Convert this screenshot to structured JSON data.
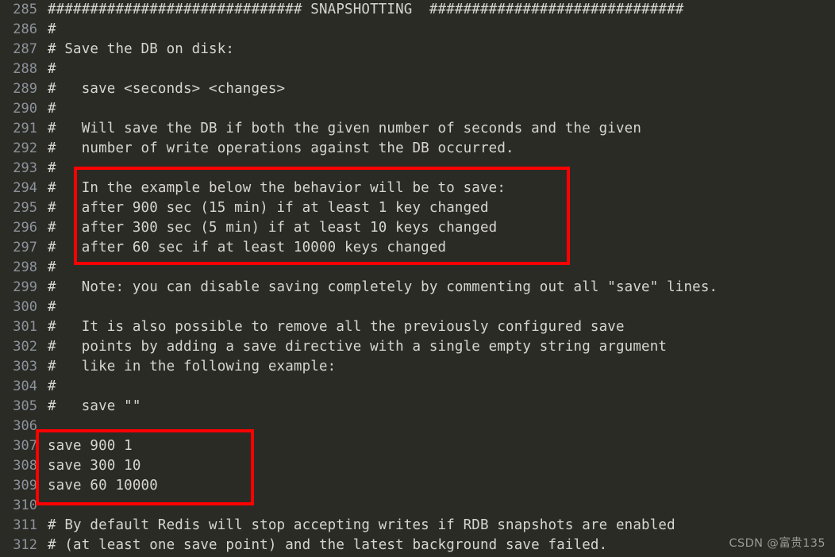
{
  "editor": {
    "background_color": "#2b2b26",
    "text_color": "#d6d6cf",
    "gutter_color": "#8d939b",
    "first_line_number": 285,
    "lines": [
      {
        "number": "285",
        "text": "############################## SNAPSHOTTING  ##############################"
      },
      {
        "number": "286",
        "text": "#"
      },
      {
        "number": "287",
        "text": "# Save the DB on disk:"
      },
      {
        "number": "288",
        "text": "#"
      },
      {
        "number": "289",
        "text": "#   save <seconds> <changes>"
      },
      {
        "number": "290",
        "text": "#"
      },
      {
        "number": "291",
        "text": "#   Will save the DB if both the given number of seconds and the given"
      },
      {
        "number": "292",
        "text": "#   number of write operations against the DB occurred."
      },
      {
        "number": "293",
        "text": "#"
      },
      {
        "number": "294",
        "text": "#   In the example below the behavior will be to save:"
      },
      {
        "number": "295",
        "text": "#   after 900 sec (15 min) if at least 1 key changed"
      },
      {
        "number": "296",
        "text": "#   after 300 sec (5 min) if at least 10 keys changed"
      },
      {
        "number": "297",
        "text": "#   after 60 sec if at least 10000 keys changed"
      },
      {
        "number": "298",
        "text": "#"
      },
      {
        "number": "299",
        "text": "#   Note: you can disable saving completely by commenting out all \"save\" lines."
      },
      {
        "number": "300",
        "text": "#"
      },
      {
        "number": "301",
        "text": "#   It is also possible to remove all the previously configured save"
      },
      {
        "number": "302",
        "text": "#   points by adding a save directive with a single empty string argument"
      },
      {
        "number": "303",
        "text": "#   like in the following example:"
      },
      {
        "number": "304",
        "text": "#"
      },
      {
        "number": "305",
        "text": "#   save \"\""
      },
      {
        "number": "306",
        "text": ""
      },
      {
        "number": "307",
        "text": "save 900 1"
      },
      {
        "number": "308",
        "text": "save 300 10"
      },
      {
        "number": "309",
        "text": "save 60 10000"
      },
      {
        "number": "310",
        "text": ""
      },
      {
        "number": "311",
        "text": "# By default Redis will stop accepting writes if RDB snapshots are enabled"
      },
      {
        "number": "312",
        "text": "# (at least one save point) and the latest background save failed."
      }
    ]
  },
  "annotations": {
    "color": "#fe0000",
    "boxes": [
      {
        "label": "save-example-comment-highlight",
        "covers_lines": "294-297"
      },
      {
        "label": "save-directives-highlight",
        "covers_lines": "307-309"
      }
    ]
  },
  "watermark": {
    "text": "CSDN @富贵135"
  }
}
